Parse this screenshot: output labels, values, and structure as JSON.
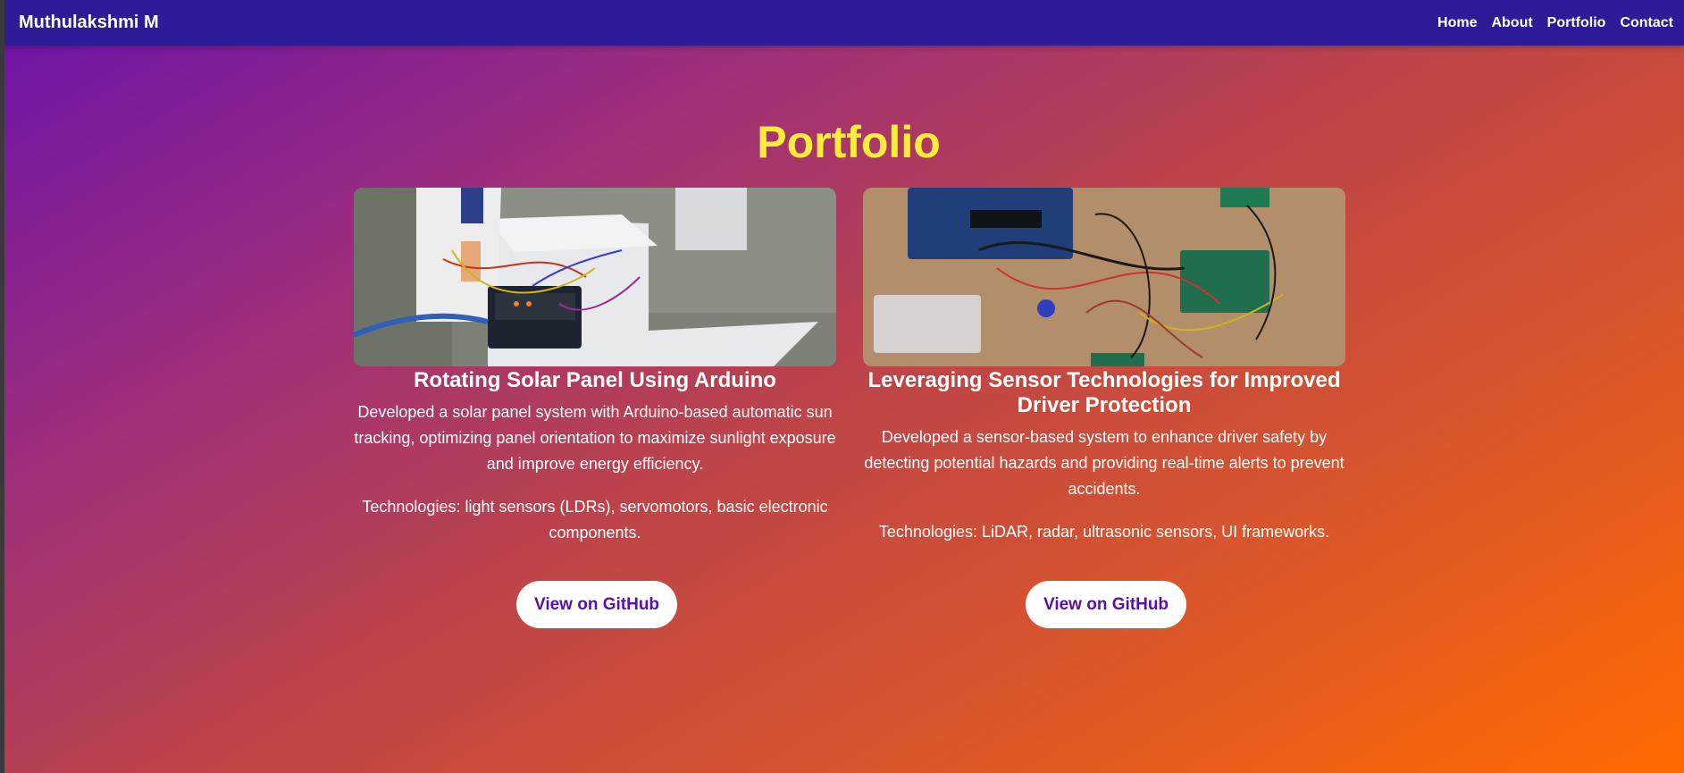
{
  "nav": {
    "brand": "Muthulakshmi M",
    "links": [
      "Home",
      "About",
      "Portfolio",
      "Contact"
    ]
  },
  "section": {
    "title": "Portfolio"
  },
  "projects": [
    {
      "title": "Rotating Solar Panel Using Arduino",
      "image_alt": "Arduino solar panel prototype",
      "description": "Developed a solar panel system with Arduino-based automatic sun tracking, optimizing panel orientation to maximize sunlight exposure and improve energy efficiency.",
      "technologies": "Technologies: light sensors (LDRs), servomotors, basic electronic components.",
      "button": "View on GitHub"
    },
    {
      "title": "Leveraging Sensor Technologies for Improved Driver Protection",
      "image_alt": "Sensor circuit boards and wiring",
      "description": "Developed a sensor-based system to enhance driver safety by detecting potential hazards and providing real-time alerts to prevent accidents.",
      "technologies": "Technologies: LiDAR, radar, ultrasonic sensors, UI frameworks.",
      "button": "View on GitHub"
    }
  ],
  "colors": {
    "navbar": "#2d1c96",
    "heading": "#ffec3d",
    "button_text": "#5a0fa8",
    "gradient_start": "#6b12ab",
    "gradient_end": "#ff6a00"
  }
}
